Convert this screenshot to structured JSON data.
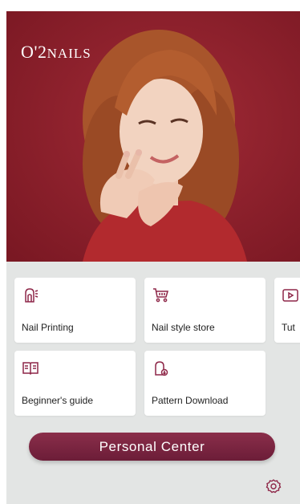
{
  "hero": {
    "brand_prefix": "O'2",
    "brand_suffix": "NAILS"
  },
  "menu": {
    "items": [
      {
        "label": "Nail Printing",
        "icon": "nail-printer-icon"
      },
      {
        "label": "Nail style store",
        "icon": "shopping-cart-icon"
      },
      {
        "label": "Tut",
        "icon": "play-video-icon"
      },
      {
        "label": "Beginner's guide",
        "icon": "open-book-icon"
      },
      {
        "label": "Pattern Download",
        "icon": "pattern-download-icon"
      }
    ]
  },
  "personal_center": {
    "label": "Personal Center"
  },
  "settings": {
    "icon": "gear-icon"
  },
  "colors": {
    "accent": "#7a2540",
    "icon": "#8e2748",
    "hero_background": "#8e1f2b",
    "panel_background": "#e3e5e4"
  }
}
